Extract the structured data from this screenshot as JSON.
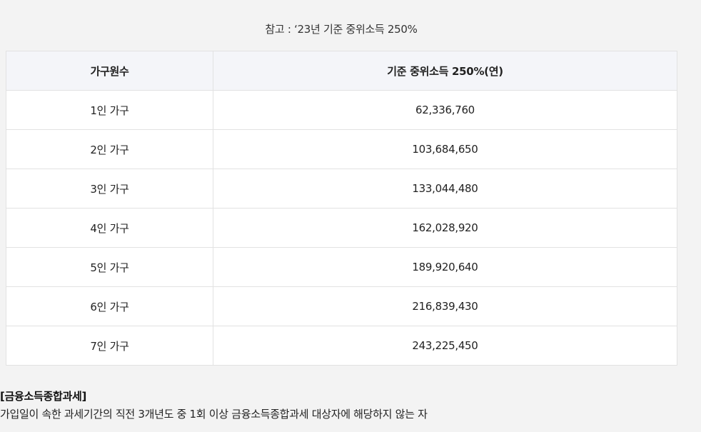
{
  "caption": "참고 : ‘23년 기준 중위소득 250%",
  "table": {
    "headers": [
      "가구원수",
      "기준 중위소득 250%(연)"
    ],
    "rows": [
      {
        "household": "1인 가구",
        "income": "62,336,760"
      },
      {
        "household": "2인 가구",
        "income": "103,684,650"
      },
      {
        "household": "3인 가구",
        "income": "133,044,480"
      },
      {
        "household": "4인 가구",
        "income": "162,028,920"
      },
      {
        "household": "5인 가구",
        "income": "189,920,640"
      },
      {
        "household": "6인 가구",
        "income": "216,839,430"
      },
      {
        "household": "7인 가구",
        "income": "243,225,450"
      }
    ]
  },
  "section": {
    "title": "[금융소득종합과세]",
    "description": "가입일이 속한 과세기간의 직전 3개년도 중 1회 이상 금융소득종합과세 대상자에 해당하지 않는 자"
  }
}
